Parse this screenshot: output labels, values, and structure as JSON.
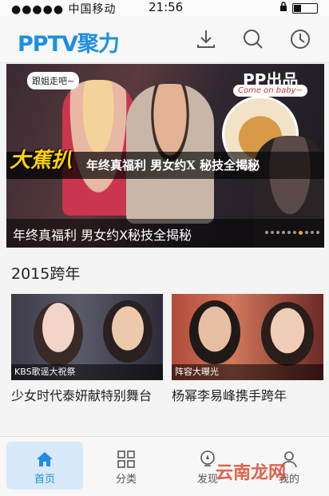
{
  "status_bar": {
    "carrier": "●●●●● 中国移动",
    "time": "21:56"
  },
  "header": {
    "app_name": "PPTV聚力"
  },
  "banner": {
    "bubble_left": "跟姐走吧~",
    "bubble_right": "Come on baby~",
    "brand_badge": "PP出品",
    "show_logo": "大蕉扒",
    "promo_text": "年终真福利 男女约X 秘技全揭秘",
    "caption": "年终真福利 男女约X秘技全揭秘",
    "slide_count": 10,
    "active_slide": 6
  },
  "section": {
    "title": "2015跨年"
  },
  "cards": [
    {
      "tag": "KBS歌谣大祝祭",
      "title": "少女时代泰妍献特别舞台"
    },
    {
      "tag": "阵容大曝光",
      "title": "杨幂李易峰携手跨年"
    }
  ],
  "tabbar": {
    "tabs": [
      {
        "label": "首页",
        "icon": "home-icon",
        "active": true
      },
      {
        "label": "分类",
        "icon": "grid-icon",
        "active": false
      },
      {
        "label": "发现",
        "icon": "discover-icon",
        "active": false
      },
      {
        "label": "我的",
        "icon": "user-icon",
        "active": false
      }
    ]
  },
  "watermark": "云南龙网",
  "colors": {
    "brand": "#1d8fe0",
    "active_tab_bg": "#d7e9f8",
    "active_dot": "#f2a62a"
  }
}
